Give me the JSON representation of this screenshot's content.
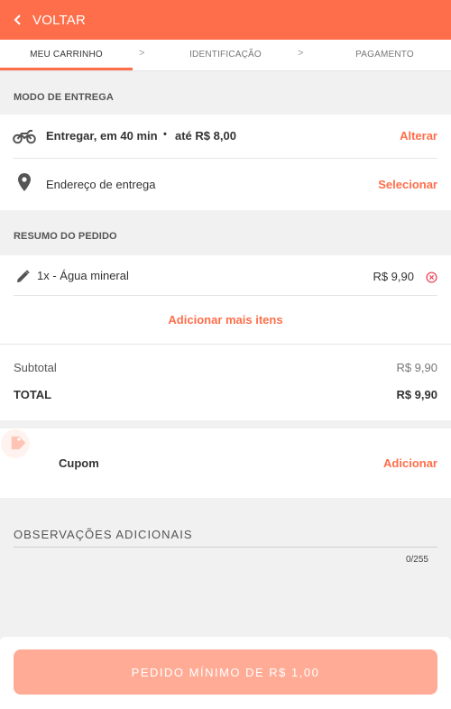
{
  "topbar": {
    "back_label": "VOLTAR"
  },
  "steps": [
    {
      "label": "MEU CARRINHO"
    },
    {
      "label": "IDENTIFICAÇÃO"
    },
    {
      "label": "PAGAMENTO"
    }
  ],
  "step_separator": ">",
  "delivery": {
    "section_label": "MODO DE ENTREGA",
    "mode_text": "Entregar, em 40 min",
    "bullet": "•",
    "fee_text": "até R$ 8,00",
    "change_label": "Alterar",
    "address_label": "Endereço de entrega",
    "select_label": "Selecionar"
  },
  "order": {
    "section_label": "RESUMO DO PEDIDO",
    "items": [
      {
        "description": "1x - Água mineral",
        "price": "R$ 9,90"
      }
    ],
    "add_more_label": "Adicionar mais itens"
  },
  "totals": {
    "subtotal_label": "Subtotal",
    "subtotal_value": "R$ 9,90",
    "total_label": "TOTAL",
    "total_value": "R$ 9,90"
  },
  "coupon": {
    "label": "Cupom",
    "add_label": "Adicionar"
  },
  "notes": {
    "title": "OBSERVAÇÕES ADICIONAIS",
    "counter": "0/255"
  },
  "footer": {
    "cta_label": "PEDIDO MÍNIMO DE R$ 1,00"
  },
  "colors": {
    "accent": "#ff6e4a",
    "cta_disabled": "#ffab95"
  }
}
